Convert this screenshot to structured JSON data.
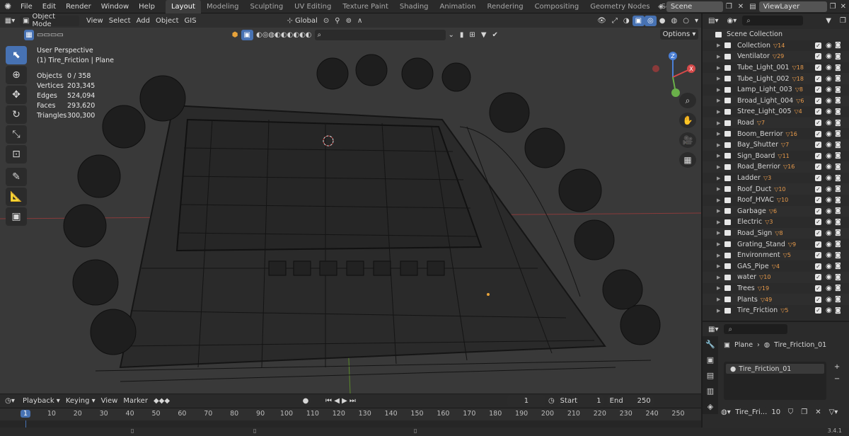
{
  "menu": {
    "items": [
      "File",
      "Edit",
      "Render",
      "Window",
      "Help"
    ]
  },
  "workspaces": [
    "Layout",
    "Modeling",
    "Sculpting",
    "UV Editing",
    "Texture Paint",
    "Shading",
    "Animation",
    "Rendering",
    "Compositing",
    "Geometry Nodes",
    "Scripting"
  ],
  "active_workspace": "Layout",
  "scene": {
    "label": "Scene",
    "view_layer": "ViewLayer"
  },
  "viewport": {
    "mode": "Object Mode",
    "menus": [
      "View",
      "Select",
      "Add",
      "Object",
      "GIS"
    ],
    "orientation": "Global",
    "options": "Options",
    "perspective": "User Perspective",
    "active": "(1) Tire_Friction | Plane",
    "stats": [
      {
        "k": "Objects",
        "v": "0 / 358"
      },
      {
        "k": "Vertices",
        "v": "203,345"
      },
      {
        "k": "Edges",
        "v": "524,094"
      },
      {
        "k": "Faces",
        "v": "293,620"
      },
      {
        "k": "Triangles",
        "v": "300,300"
      }
    ],
    "gizmo": {
      "z": "Z",
      "x": "X"
    }
  },
  "outliner": {
    "root": "Scene Collection",
    "items": [
      {
        "name": "Collection",
        "count": "14"
      },
      {
        "name": "Ventilator",
        "count": "29"
      },
      {
        "name": "Tube_Light_001",
        "count": "18"
      },
      {
        "name": "Tube_Light_002",
        "count": "18"
      },
      {
        "name": "Lamp_Light_003",
        "count": "8"
      },
      {
        "name": "Broad_Light_004",
        "count": "6"
      },
      {
        "name": "Stree_Light_005",
        "count": "4"
      },
      {
        "name": "Road",
        "count": "7"
      },
      {
        "name": "Boom_Berrior",
        "count": "16"
      },
      {
        "name": "Bay_Shutter",
        "count": "7"
      },
      {
        "name": "Sign_Board",
        "count": "11"
      },
      {
        "name": "Road_Berrior",
        "count": "16"
      },
      {
        "name": "Ladder",
        "count": "3"
      },
      {
        "name": "Roof_Duct",
        "count": "10"
      },
      {
        "name": "Roof_HVAC",
        "count": "10"
      },
      {
        "name": "Garbage",
        "count": "6"
      },
      {
        "name": "Electric",
        "count": "3"
      },
      {
        "name": "Road_Sign",
        "count": "8"
      },
      {
        "name": "Grating_Stand",
        "count": "9"
      },
      {
        "name": "Environment",
        "count": "5"
      },
      {
        "name": "GAS_Pipe",
        "count": "4"
      },
      {
        "name": "water",
        "count": "10"
      },
      {
        "name": "Trees",
        "count": "19"
      },
      {
        "name": "Plants",
        "count": "49"
      },
      {
        "name": "Tire_Friction",
        "count": "5"
      }
    ]
  },
  "properties": {
    "breadcrumb_obj": "Plane",
    "breadcrumb_mat": "Tire_Friction_01",
    "slot": "Tire_Friction_01",
    "material_field": "Tire_Fri...",
    "users": "10"
  },
  "timeline": {
    "menus": [
      "Playback",
      "Keying",
      "View",
      "Marker"
    ],
    "current_frame": "1",
    "start_label": "Start",
    "start": "1",
    "end_label": "End",
    "end": "250",
    "ticks": [
      "1",
      "10",
      "20",
      "30",
      "40",
      "50",
      "60",
      "70",
      "80",
      "90",
      "100",
      "110",
      "120",
      "130",
      "140",
      "150",
      "160",
      "170",
      "180",
      "190",
      "200",
      "210",
      "220",
      "230",
      "240",
      "250"
    ]
  },
  "version": "3.4.1"
}
